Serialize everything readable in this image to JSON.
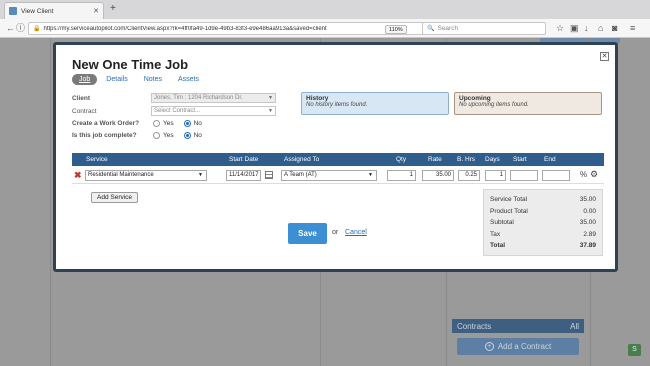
{
  "browser": {
    "tab_title": "View Client",
    "url": "https://my.serviceautopilot.com/ClientView.aspx?rk=4ff0fa49-1d9e-49b3-83f3-e9e486aa913a&saved=client",
    "zoom": "110%",
    "search_placeholder": "Search"
  },
  "background": {
    "contracts_label": "Contracts",
    "contracts_filter": "All",
    "add_contract_label": "Add a Contract"
  },
  "modal": {
    "title": "New One Time Job",
    "tabs": [
      "Job",
      "Details",
      "Notes",
      "Assets"
    ],
    "form": {
      "client_label": "Client",
      "client_value": "Jones, Tim : 1204 Richardson Dr.",
      "contract_label": "Contract",
      "contract_placeholder": "Select Contract...",
      "work_order_label": "Create a Work Order?",
      "complete_label": "Is this job complete?",
      "yes": "Yes",
      "no": "No",
      "work_order_selected": "No",
      "complete_selected": "No"
    },
    "history": {
      "title": "History",
      "text": "No history items found."
    },
    "upcoming": {
      "title": "Upcoming",
      "text": "No upcoming items found."
    },
    "table": {
      "headers": [
        "Service",
        "Start Date",
        "Assigned To",
        "Qty",
        "Rate",
        "B. Hrs",
        "Days",
        "Start",
        "End"
      ],
      "row": {
        "service": "Residential Maintenance",
        "start_date": "11/14/2017",
        "assigned_to": "A Team (AT)",
        "qty": "1",
        "rate": "35.00",
        "b_hrs": "0.25",
        "days": "1",
        "start": "",
        "end": ""
      }
    },
    "add_service_label": "Add Service",
    "totals": [
      {
        "label": "Service Total",
        "value": "35.00"
      },
      {
        "label": "Product Total",
        "value": "0.00"
      },
      {
        "label": "Subtotal",
        "value": "35.00"
      },
      {
        "label": "Tax",
        "value": "2.89"
      },
      {
        "label": "Total",
        "value": "37.89"
      }
    ],
    "save_label": "Save",
    "or_label": "or",
    "cancel_label": "Cancel"
  },
  "colors": {
    "header_blue": "#2f5d8c",
    "save_blue": "#3d8fd3",
    "delete_red": "#c0392b",
    "overlay_gray": "#9a9a9a"
  }
}
